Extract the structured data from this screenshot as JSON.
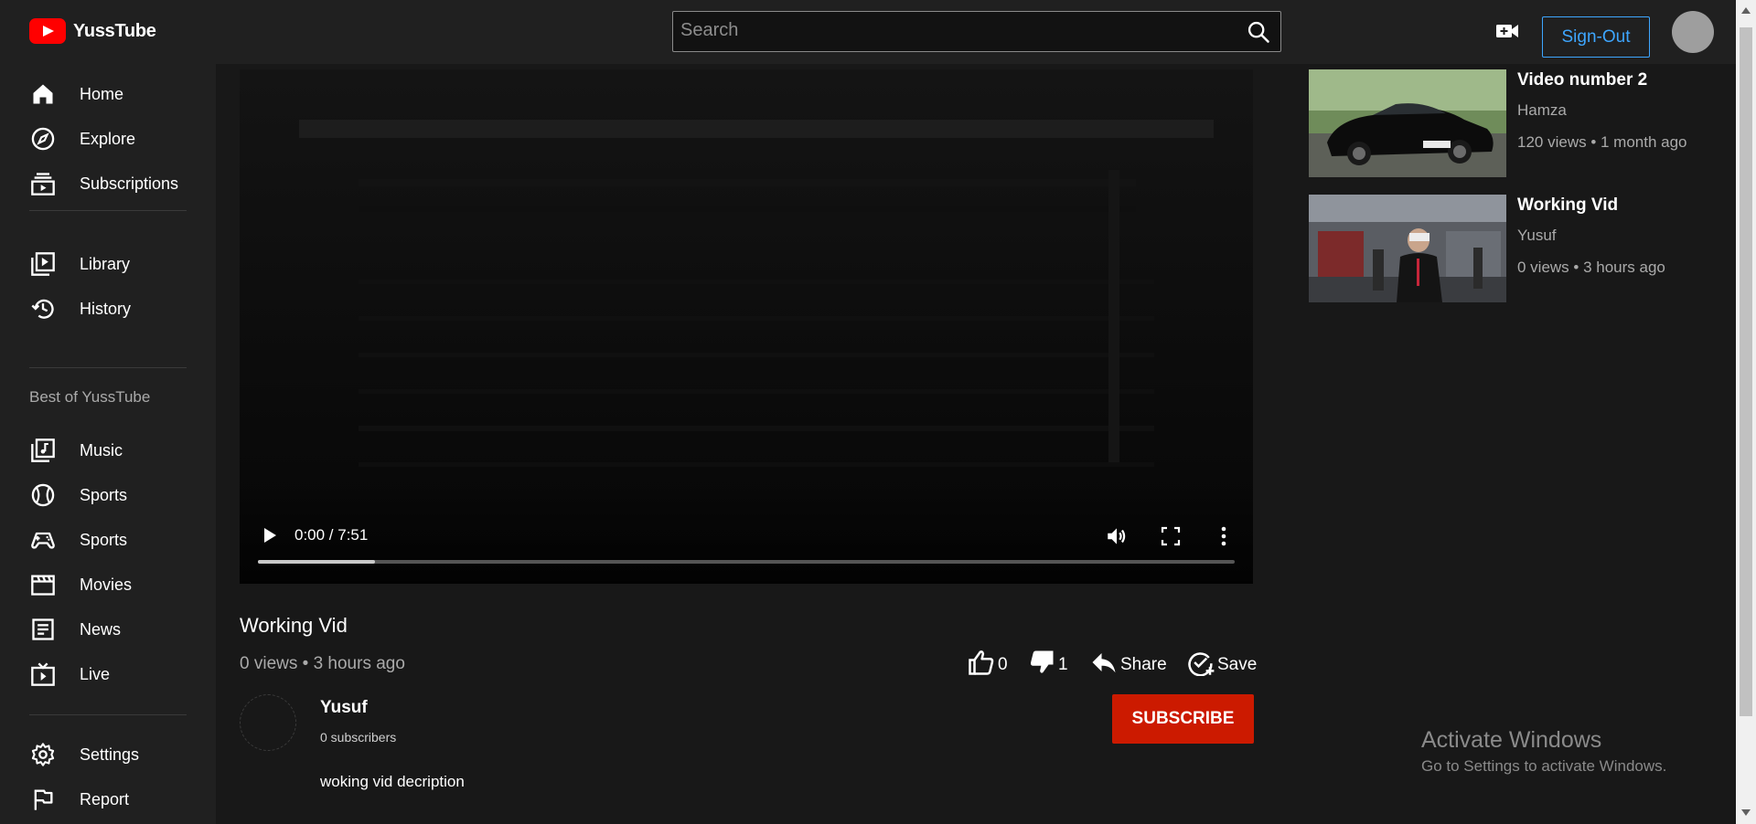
{
  "app": {
    "name": "YussTube",
    "brand_color": "#ff0000"
  },
  "header": {
    "search_placeholder": "Search",
    "search_value": "",
    "signout_label": "Sign-Out",
    "icons": [
      "search-icon",
      "create-video-icon"
    ]
  },
  "sidebar": {
    "primary": [
      {
        "label": "Home",
        "icon": "home-icon"
      },
      {
        "label": "Explore",
        "icon": "compass-icon"
      },
      {
        "label": "Subscriptions",
        "icon": "subscriptions-icon"
      }
    ],
    "library": [
      {
        "label": "Library",
        "icon": "library-icon"
      },
      {
        "label": "History",
        "icon": "history-icon"
      }
    ],
    "section_title": "Best of YussTube",
    "best_of": [
      {
        "label": "Music",
        "icon": "music-icon"
      },
      {
        "label": "Sports",
        "icon": "sports-ball-icon"
      },
      {
        "label": "Sports",
        "icon": "gamepad-icon"
      },
      {
        "label": "Movies",
        "icon": "clapperboard-icon"
      },
      {
        "label": "News",
        "icon": "news-icon"
      },
      {
        "label": "Live",
        "icon": "live-tv-icon"
      }
    ],
    "footer": [
      {
        "label": "Settings",
        "icon": "gear-icon"
      },
      {
        "label": "Report",
        "icon": "flag-icon"
      }
    ]
  },
  "player": {
    "time": "0:00 / 7:51",
    "progress_fraction": 0.12
  },
  "video": {
    "title": "Working Vid",
    "meta": "0 views • 3 hours ago",
    "likes": "0",
    "dislikes": "1",
    "share_label": "Share",
    "save_label": "Save",
    "channel": "Yusuf",
    "subscribers": "0 subscribers",
    "subscribe_label": "SUBSCRIBE",
    "description": "woking vid decription"
  },
  "recommendations": [
    {
      "title": "Video number 2",
      "channel": "Hamza",
      "meta": "120 views • 1 month ago",
      "thumb": "black-car-thumbnail"
    },
    {
      "title": "Working Vid",
      "channel": "Yusuf",
      "meta": "0 views • 3 hours ago",
      "thumb": "vr-event-thumbnail"
    }
  ],
  "watermark": {
    "title": "Activate Windows",
    "subtitle": "Go to Settings to activate Windows."
  },
  "colors": {
    "background": "#181818",
    "surface": "#202020",
    "accent_blue": "#3ea6ff",
    "subscribe_red": "#cc1a00"
  }
}
